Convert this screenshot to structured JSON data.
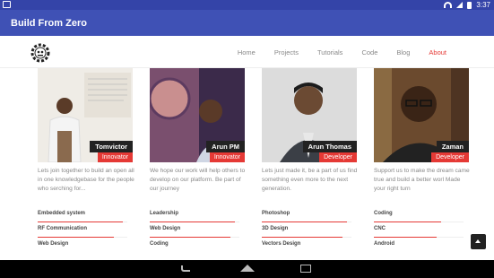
{
  "status_bar": {
    "time": "3:37",
    "colors": {
      "background": "#3444a8"
    },
    "icons": [
      "notification-icon",
      "wifi-icon",
      "signal-icon",
      "battery-icon"
    ]
  },
  "app_bar": {
    "title": "Build From Zero",
    "color": "#3f51b5"
  },
  "nav": {
    "items": [
      "Home",
      "Projects",
      "Tutorials",
      "Code",
      "Blog",
      "About"
    ],
    "active": "About",
    "accent": "#e53935"
  },
  "team": [
    {
      "name": "Tomvictor",
      "role": "Innovator",
      "bio": "Lets join together to build an open all in one knowledgebase for the people who serching for...",
      "skills": [
        {
          "label": "Embedded system",
          "level": 0.95
        },
        {
          "label": "RF Communication",
          "level": 0.85
        },
        {
          "label": "Web Design",
          "level": 0.0
        }
      ]
    },
    {
      "name": "Arun PM",
      "role": "Innovator",
      "bio": "We hope our work will help others to develop on our platform. Be part of our journey",
      "skills": [
        {
          "label": "Leadership",
          "level": 0.95
        },
        {
          "label": "Web Design",
          "level": 0.9
        },
        {
          "label": "Coding",
          "level": 0.0
        }
      ]
    },
    {
      "name": "Arun Thomas",
      "role": "Developer",
      "bio": "Lets just made it, be a part of us find something even more to the next generation.",
      "skills": [
        {
          "label": "Photoshop",
          "level": 0.95
        },
        {
          "label": "3D Design",
          "level": 0.9
        },
        {
          "label": "Vectors Design",
          "level": 0.0
        }
      ]
    },
    {
      "name": "Zaman",
      "role": "Developer",
      "bio": "Support us to make the dream came true and build a better worl Made your right turn",
      "skills": [
        {
          "label": "Coding",
          "level": 0.75
        },
        {
          "label": "CNC",
          "level": 0.7
        },
        {
          "label": "Android",
          "level": 0.0
        }
      ]
    }
  ],
  "icons": {
    "logo": "gear-robot-logo-icon",
    "scroll_top": "chevron-up-icon",
    "system_nav": [
      "back-icon",
      "home-icon",
      "recent-apps-icon"
    ]
  }
}
